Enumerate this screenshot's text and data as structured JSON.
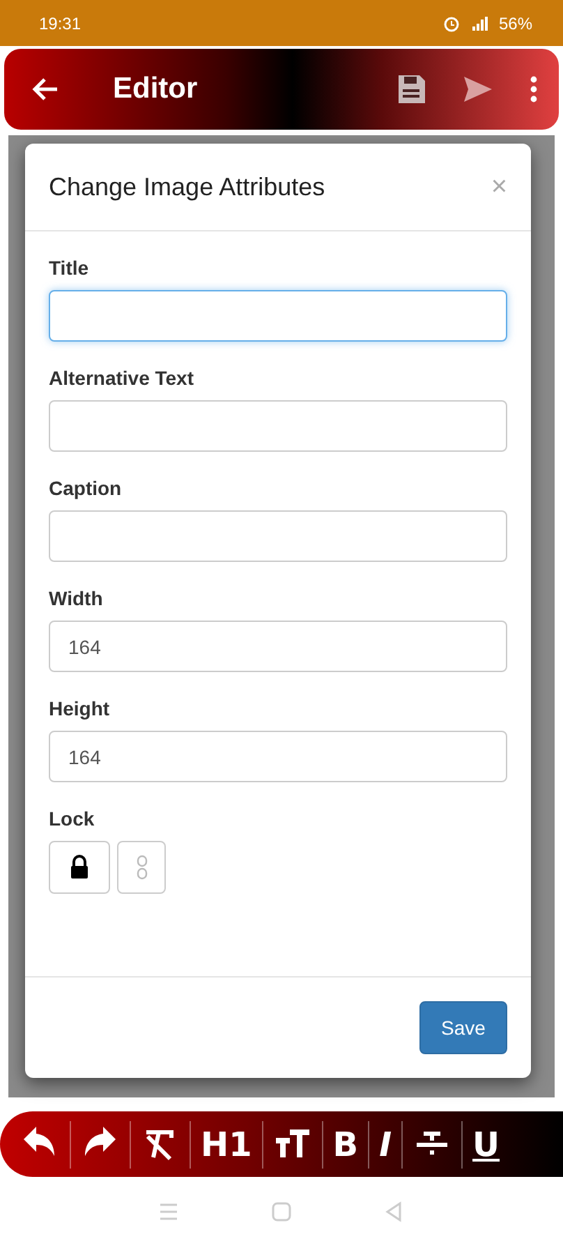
{
  "status_bar": {
    "time": "19:31",
    "battery": "56%"
  },
  "app_bar": {
    "title": "Editor"
  },
  "dialog": {
    "title": "Change Image Attributes",
    "close": "×",
    "fields": [
      {
        "label": "Title",
        "focused": true
      },
      {
        "label": "Alternative Text",
        "focused": false
      },
      {
        "label": "Caption",
        "focused": false
      },
      {
        "label": "Width",
        "value": "164",
        "focused": false
      },
      {
        "label": "Height",
        "value": "164",
        "focused": false
      }
    ],
    "lock": {
      "label": "Lock",
      "options": [
        {
          "kind": "lock",
          "selected": true
        },
        {
          "kind": "unlink",
          "selected": false
        }
      ]
    },
    "save": "Save"
  },
  "toolbar": [
    {
      "kind": "undo"
    },
    {
      "kind": "redo"
    },
    {
      "kind": "clear"
    },
    {
      "kind": "text",
      "label": "H1"
    },
    {
      "kind": "size"
    },
    {
      "kind": "text",
      "label": "B"
    },
    {
      "kind": "italic",
      "label": "I"
    },
    {
      "kind": "strike"
    },
    {
      "kind": "underline",
      "label": "U"
    }
  ]
}
